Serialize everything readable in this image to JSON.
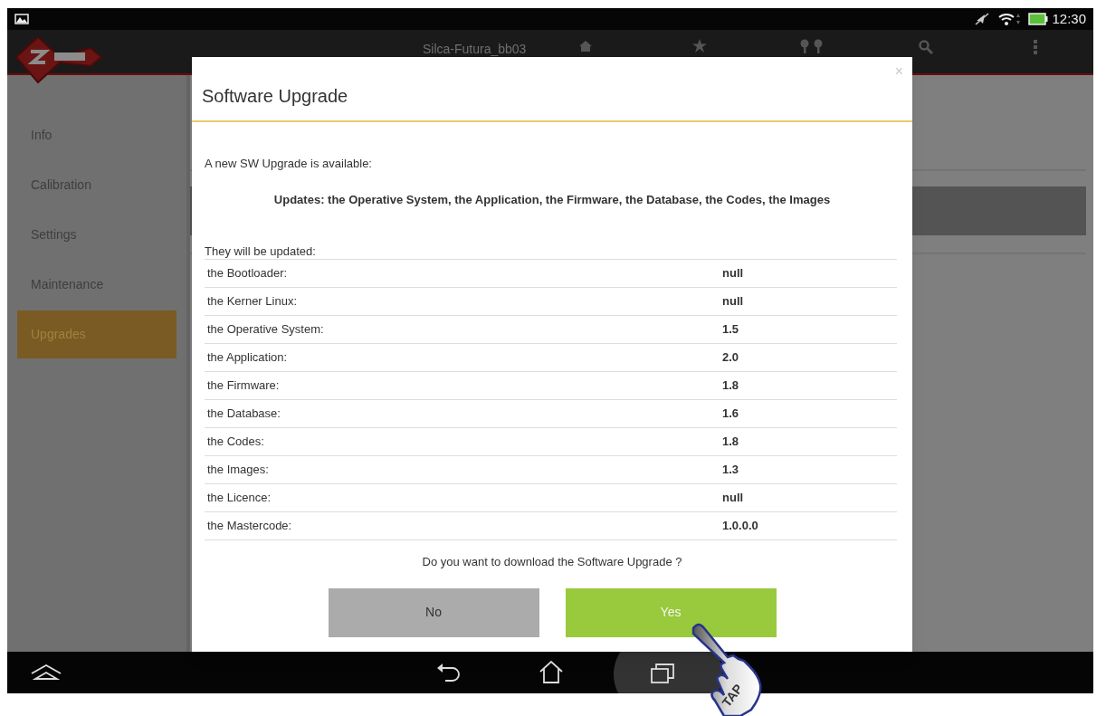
{
  "status_bar": {
    "time": "12:30"
  },
  "app_bar": {
    "title": "Silca-Futura_bb03"
  },
  "sidebar": {
    "items": [
      {
        "label": "Info",
        "selected": false
      },
      {
        "label": "Calibration",
        "selected": false
      },
      {
        "label": "Settings",
        "selected": false
      },
      {
        "label": "Maintenance",
        "selected": false
      },
      {
        "label": "Upgrades",
        "selected": true
      }
    ]
  },
  "dialog": {
    "title": "Software Upgrade",
    "close": "×",
    "intro": "A new SW Upgrade is available:",
    "summary": "Updates: the Operative System, the Application, the Firmware, the Database, the Codes, the Images",
    "list_heading": "They will be updated:",
    "rows": [
      {
        "label": "the Bootloader:",
        "value": "null"
      },
      {
        "label": "the Kerner Linux:",
        "value": "null"
      },
      {
        "label": "the Operative System:",
        "value": "1.5"
      },
      {
        "label": "the Application:",
        "value": "2.0"
      },
      {
        "label": "the Firmware:",
        "value": "1.8"
      },
      {
        "label": "the Database:",
        "value": "1.6"
      },
      {
        "label": "the Codes:",
        "value": "1.8"
      },
      {
        "label": "the Images:",
        "value": "1.3"
      },
      {
        "label": "the Licence:",
        "value": "null"
      },
      {
        "label": "the Mastercode:",
        "value": "1.0.0.0"
      }
    ],
    "question": "Do you want to download the Software Upgrade ?",
    "buttons": [
      {
        "label": "No",
        "kind": "secondary"
      },
      {
        "label": "Yes",
        "kind": "primary"
      }
    ]
  },
  "annotation": {
    "label": "TAP"
  }
}
